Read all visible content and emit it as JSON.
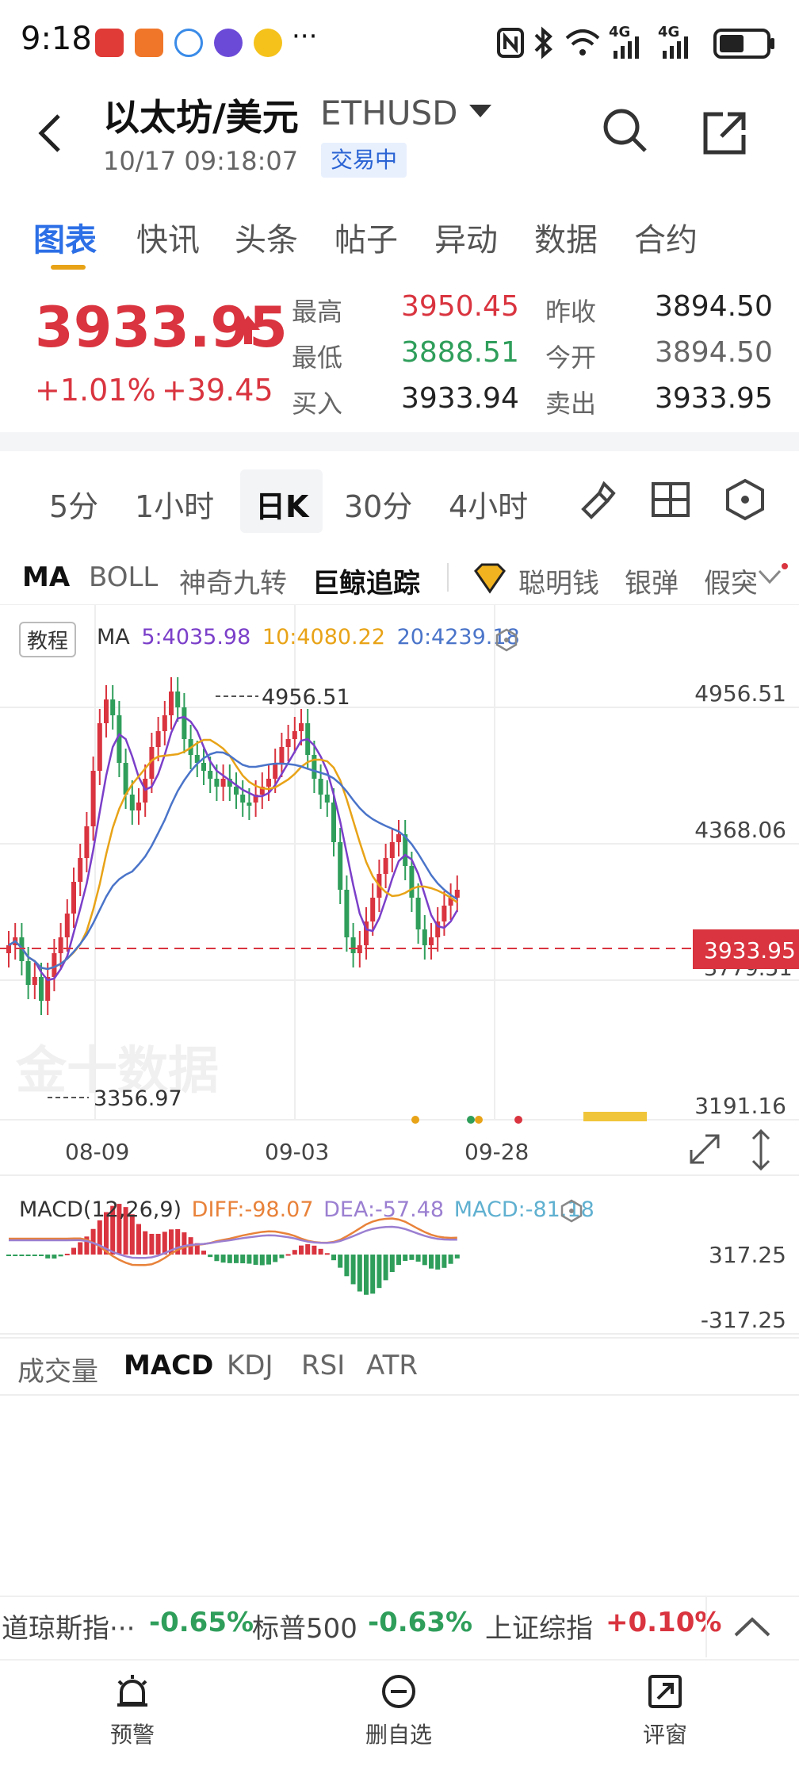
{
  "status_bar": {
    "time": "9:18",
    "more": "···",
    "icons": [
      "huawei-app-icon",
      "shop-app-icon",
      "chat-app-icon",
      "browser-app-icon",
      "weibo-app-icon",
      "nfc-icon",
      "bluetooth-icon",
      "wifi-icon",
      "signal-4g-icon",
      "signal-4g-icon",
      "battery-icon"
    ],
    "signal_label": "4G"
  },
  "header": {
    "title": "以太坊/美元",
    "code": "ETHUSD",
    "datetime": "10/17 09:18:07",
    "status_badge": "交易中"
  },
  "tabs": [
    "图表",
    "快讯",
    "头条",
    "帖子",
    "异动",
    "数据",
    "合约"
  ],
  "quote": {
    "price": "3933.95",
    "change_pct": "+1.01%",
    "change_abs": "+39.45",
    "high_label": "最高",
    "high": "3950.45",
    "low_label": "最低",
    "low": "3888.51",
    "bid_label": "买入",
    "bid": "3933.94",
    "prev_close_label": "昨收",
    "prev_close": "3894.50",
    "open_label": "今开",
    "open": "3894.50",
    "ask_label": "卖出",
    "ask": "3933.95"
  },
  "period_tabs": [
    "5分",
    "1小时",
    "日K",
    "30分",
    "4小时"
  ],
  "period_active": "日K",
  "indicator_tabs": [
    "MA",
    "BOLL",
    "神奇九转",
    "巨鲸追踪",
    "聪明钱",
    "银弹",
    "假突"
  ],
  "chart": {
    "tutorial_label": "教程",
    "ma_legend": {
      "label": "MA",
      "ma5": "5:4035.98",
      "ma10": "10:4080.22",
      "ma20": "20:4239.18"
    },
    "y_labels": [
      "4956.51",
      "4368.06",
      "3191.16"
    ],
    "current_price_tag": "3933.95",
    "obscured_label": "3779.51",
    "high_annotation": "4956.51",
    "low_annotation": "3356.97",
    "x_labels": [
      "08-09",
      "09-03",
      "09-28"
    ],
    "watermark": "金十数据",
    "colors": {
      "up": "#d9343f",
      "down": "#2f9e5b",
      "ma5": "#7b3fc9",
      "ma10": "#e8a317",
      "ma20": "#4a74c9",
      "current": "#d9343f"
    }
  },
  "macd": {
    "label": "MACD(12,26,9)",
    "diff": "DIFF:-98.07",
    "dea": "DEA:-57.48",
    "macd": "MACD:-81.18",
    "y_top": "317.25",
    "y_bottom": "-317.25",
    "colors": {
      "diff": "#e8823a",
      "dea": "#9b7fd1",
      "macd": "#5fb0d0"
    }
  },
  "bottom_tabs": [
    "成交量",
    "MACD",
    "KDJ",
    "RSI",
    "ATR"
  ],
  "bottom_active": "MACD",
  "ticker": [
    {
      "name": "道琼斯指···",
      "value": "-0.65%"
    },
    {
      "name": "标普500",
      "value": "-0.63%"
    },
    {
      "name": "上证综指",
      "value": "+0.10%"
    }
  ],
  "nav": [
    {
      "label": "预警",
      "icon": "alarm-icon"
    },
    {
      "label": "删自选",
      "icon": "remove-watchlist-icon"
    },
    {
      "label": "评窗",
      "icon": "share-icon"
    }
  ]
}
